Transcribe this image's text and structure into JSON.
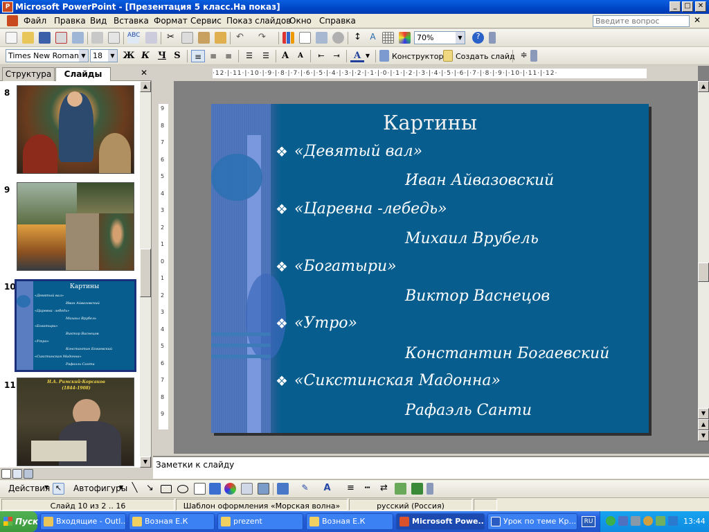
{
  "window": {
    "title": "Microsoft PowerPoint - [Презентация 5 класс.На показ]",
    "app_icon": "powerpoint-icon"
  },
  "menu": [
    "Файл",
    "Правка",
    "Вид",
    "Вставка",
    "Формат",
    "Сервис",
    "Показ слайдов",
    "Окно",
    "Справка"
  ],
  "ask_placeholder": "Введите вопрос",
  "toolbar": {
    "zoom": "70%",
    "font": "Times New Roman",
    "font_size": "18",
    "bold": "Ж",
    "italic": "К",
    "underline": "Ч",
    "shadow": "S",
    "font_color": "A",
    "designer": "Конструктор",
    "new_slide": "Создать слайд"
  },
  "pane_tabs": {
    "outline": "Структура",
    "slides": "Слайды"
  },
  "thumbnails": [
    {
      "num": "8"
    },
    {
      "num": "9"
    },
    {
      "num": "10",
      "selected": true
    },
    {
      "num": "11",
      "caption": "Н.А. Римский-Корсаков",
      "years": "(1844-1908)"
    }
  ],
  "slide": {
    "title": "Картины",
    "items": [
      {
        "work": "«Девятый вал»",
        "author": "Иван Айвазовский"
      },
      {
        "work": "«Царевна -лебедь»",
        "author": "Михаил Врубель"
      },
      {
        "work": "«Богатыри»",
        "author": "Виктор Васнецов"
      },
      {
        "work": "«Утро»",
        "author": "Константин Богаевский"
      },
      {
        "work": "«Сикстинская Мадонна»",
        "author": "Рафаэль Санти"
      }
    ]
  },
  "mini_slide": {
    "title": "Картины",
    "items": [
      "«Девятый вал»",
      "Иван Айвазовский",
      "«Царевна -лебедь»",
      "Михаил Врубель",
      "«Богатыри»",
      "Виктор Васнецов",
      "«Утро»",
      "Константин Богаевский",
      "«Сикстинская Мадонна»",
      "Рафаэль Санти"
    ]
  },
  "ruler_h": "·12·|·11·|·10·|·9·|·8·|·7·|·6·|·5·|·4·|·3·|·2·|·1·|·0·|·1·|·2·|·3·|·4·|·5·|·6·|·7·|·8·|·9·|·10·|·11·|·12·",
  "notes_placeholder": "Заметки к слайду",
  "drawbar": {
    "actions": "Действия",
    "autoshapes": "Автофигуры"
  },
  "status": {
    "slide": "Слайд 10 из 2 .. 16",
    "template": "Шаблон оформления «Морская волна»",
    "lang": "русский (Россия)"
  },
  "taskbar": {
    "start": "Пуск",
    "tasks": [
      "Входящие - Outl...",
      "Возная Е.К",
      "prezent",
      "Возная Е.К",
      "Microsoft Powe...",
      "Урок по теме Кр..."
    ],
    "lang": "RU",
    "clock": "13:44"
  }
}
